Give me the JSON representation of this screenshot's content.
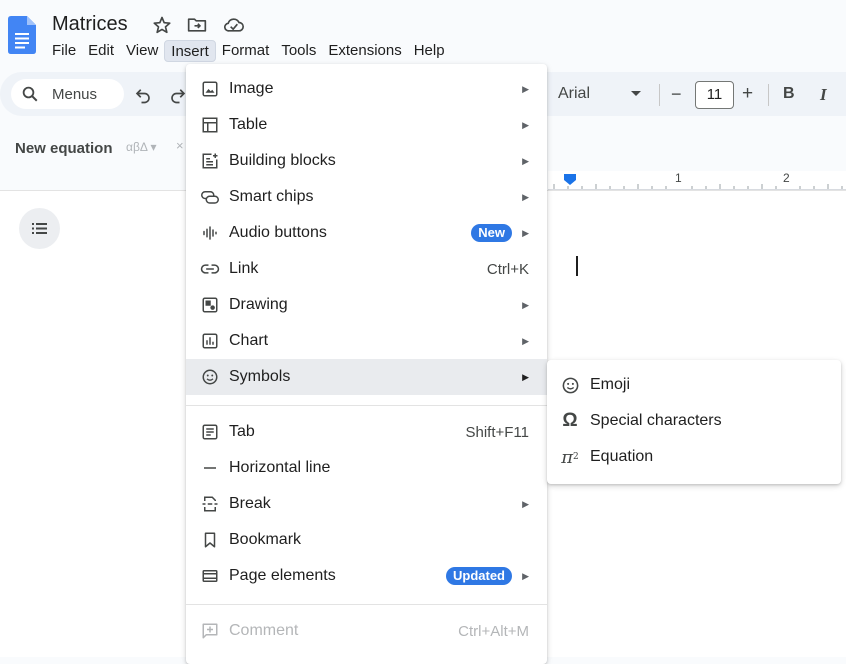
{
  "header": {
    "title": "Matrices",
    "menu": [
      "File",
      "Edit",
      "View",
      "Insert",
      "Format",
      "Tools",
      "Extensions",
      "Help"
    ],
    "active_menu": "Insert"
  },
  "toolbar": {
    "search_label": "Menus",
    "font": "Arial",
    "font_size": "11",
    "bold": "B",
    "italic": "I",
    "minus": "−",
    "plus": "+"
  },
  "equation_bar": {
    "label": "New equation",
    "symbols": "αβΔ ▾",
    "extra": "×"
  },
  "ruler": {
    "tick1": "1",
    "tick2": "2"
  },
  "insert_menu": {
    "items": [
      {
        "label": "Image",
        "icon": "image-icon",
        "submenu": true
      },
      {
        "label": "Table",
        "icon": "table-icon",
        "submenu": true
      },
      {
        "label": "Building blocks",
        "icon": "building-blocks-icon",
        "submenu": true
      },
      {
        "label": "Smart chips",
        "icon": "smart-chips-icon",
        "submenu": true
      },
      {
        "label": "Audio buttons",
        "icon": "audio-icon",
        "submenu": true,
        "badge": "New"
      },
      {
        "label": "Link",
        "icon": "link-icon",
        "shortcut": "Ctrl+K"
      },
      {
        "label": "Drawing",
        "icon": "drawing-icon",
        "submenu": true
      },
      {
        "label": "Chart",
        "icon": "chart-icon",
        "submenu": true
      },
      {
        "label": "Symbols",
        "icon": "symbols-icon",
        "submenu": true,
        "highlighted": true
      },
      {
        "label": "Tab",
        "icon": "tab-icon",
        "shortcut": "Shift+F11"
      },
      {
        "label": "Horizontal line",
        "icon": "horizontal-line-icon"
      },
      {
        "label": "Break",
        "icon": "break-icon",
        "submenu": true
      },
      {
        "label": "Bookmark",
        "icon": "bookmark-icon"
      },
      {
        "label": "Page elements",
        "icon": "page-elements-icon",
        "submenu": true,
        "badge": "Updated"
      },
      {
        "label": "Comment",
        "icon": "comment-icon",
        "shortcut": "Ctrl+Alt+M",
        "disabled": true
      }
    ]
  },
  "symbols_menu": {
    "items": [
      {
        "label": "Emoji",
        "icon": "emoji-icon"
      },
      {
        "label": "Special characters",
        "icon": "omega-icon"
      },
      {
        "label": "Equation",
        "icon": "pi-squared-icon"
      }
    ]
  }
}
